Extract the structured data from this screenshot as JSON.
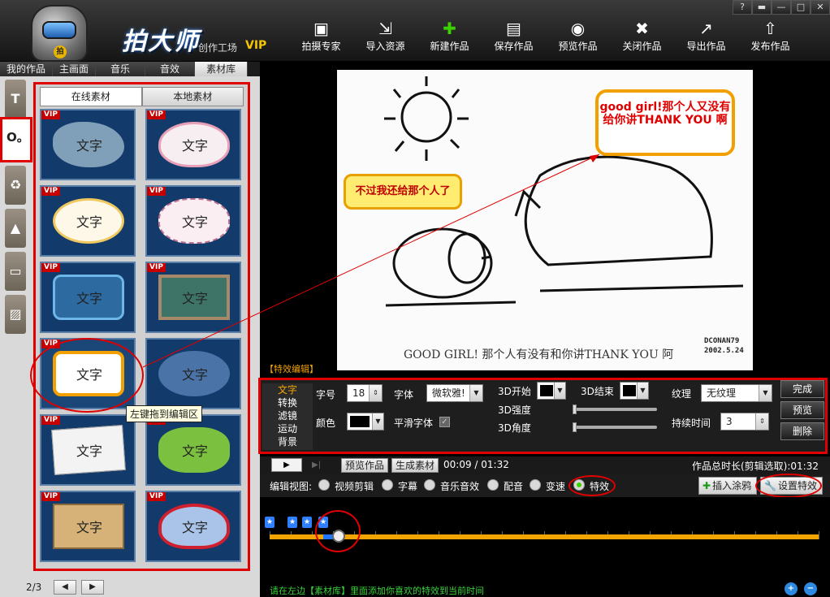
{
  "app": {
    "brand": "拍大师",
    "subtitle": "创作工场",
    "vip": "VIP",
    "logo_badge": "拍"
  },
  "toolbar": [
    {
      "label": "拍摄专家",
      "icon": "camera-icon",
      "glyph": "▣"
    },
    {
      "label": "导入资源",
      "icon": "import-icon",
      "glyph": "⇲"
    },
    {
      "label": "新建作品",
      "icon": "new-icon",
      "glyph": "✚"
    },
    {
      "label": "保存作品",
      "icon": "save-icon",
      "glyph": "▤"
    },
    {
      "label": "预览作品",
      "icon": "eye-icon",
      "glyph": "◉"
    },
    {
      "label": "关闭作品",
      "icon": "close-doc-icon",
      "glyph": "✖"
    },
    {
      "label": "导出作品",
      "icon": "export-icon",
      "glyph": "↗"
    },
    {
      "label": "发布作品",
      "icon": "upload-icon",
      "glyph": "⇧"
    }
  ],
  "window_controls": {
    "help": "?",
    "skin": "▬",
    "minimize": "—",
    "maximize": "□",
    "close": "✕"
  },
  "top_tabs": [
    "我的作品",
    "主画面",
    "音乐",
    "音效",
    "素材库"
  ],
  "side_icons": [
    "T",
    "O。",
    "♻",
    "▲",
    "▭",
    "▨"
  ],
  "library": {
    "tabs": [
      "在线素材",
      "本地素材"
    ],
    "vip_badge": "VIP",
    "cell_text": "文字",
    "tooltip": "左键拖到编辑区",
    "page_indicator": "2/3",
    "prev": "◀",
    "next": "▶"
  },
  "preview": {
    "bubble1": "good girl!那个人又没有给你讲THANK YOU 啊",
    "bubble2": "不过我还给那个人了",
    "caption": "GOOD GIRL! 那个人有没有和你讲THANK YOU 阿",
    "signature_line1": "DCONAN79",
    "signature_line2": "2002.5.24"
  },
  "effects": {
    "title": "【特效编辑】",
    "menu": [
      "文字",
      "转换",
      "滤镜",
      "运动",
      "背景"
    ],
    "font_size_label": "字号",
    "font_size": "18",
    "font_label": "字体",
    "font_value": "微软雅!",
    "start3d_label": "3D开始",
    "end3d_label": "3D结束",
    "texture_label": "纹理",
    "texture_value": "无纹理",
    "strength_label": "3D强度",
    "angle_label": "3D角度",
    "color_label": "颜色",
    "smooth_label": "平滑字体",
    "smooth_checked": "✓",
    "duration_label": "持续时间",
    "duration_value": "3",
    "buttons": [
      "完成",
      "预览",
      "删除"
    ]
  },
  "playbar": {
    "play": "▶",
    "skip": "▶|",
    "preview_btn": "预览作品",
    "generate_btn": "生成素材",
    "time": "00:09 / 01:32",
    "total": "作品总时长(剪辑选取):01:32"
  },
  "edit_view": {
    "label": "编辑视图:",
    "options": [
      "视频剪辑",
      "字幕",
      "音乐音效",
      "配音",
      "变速",
      "特效"
    ],
    "selected": "特效",
    "insert_btn": "插入涂鸦",
    "insert_icon": "✚",
    "set_btn": "设置特效",
    "set_icon": "🔧"
  },
  "timeline": {
    "marker_glyph": "★",
    "progress": 0.125
  },
  "status": {
    "message": "请在左边【素材库】里面添加你喜欢的特效到当前时间",
    "zoom_in": "+",
    "zoom_out": "−"
  },
  "colors": {
    "highlight_red": "#e00000",
    "accent_orange": "#f5a400",
    "status_green": "#38d23a"
  }
}
